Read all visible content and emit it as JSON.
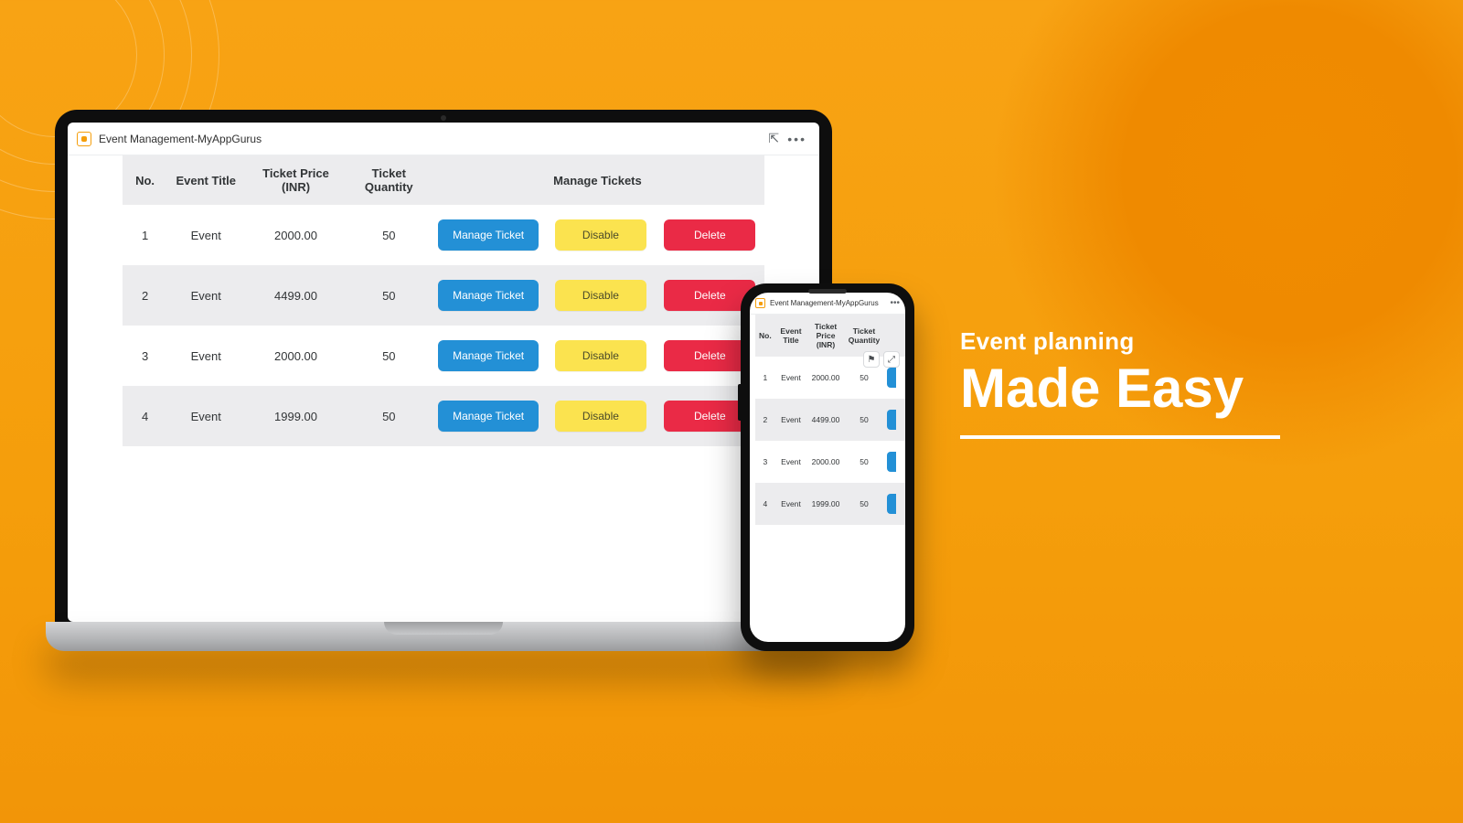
{
  "app": {
    "title": "Event Management-MyAppGurus"
  },
  "table": {
    "headers": {
      "no": "No.",
      "title": "Event Title",
      "price": "Ticket Price (INR)",
      "qty": "Ticket Quantity",
      "manage": "Manage Tickets"
    },
    "buttons": {
      "manage": "Manage Ticket",
      "disable": "Disable",
      "delete": "Delete"
    },
    "rows": [
      {
        "no": "1",
        "title": "Event",
        "price": "2000.00",
        "qty": "50"
      },
      {
        "no": "2",
        "title": "Event",
        "price": "4499.00",
        "qty": "50"
      },
      {
        "no": "3",
        "title": "Event",
        "price": "2000.00",
        "qty": "50"
      },
      {
        "no": "4",
        "title": "Event",
        "price": "1999.00",
        "qty": "50"
      }
    ]
  },
  "icons": {
    "pin": "⇱",
    "more": "•••",
    "flag": "⚑",
    "expand": "⤢"
  },
  "headline": {
    "small": "Event planning",
    "big": "Made Easy"
  }
}
